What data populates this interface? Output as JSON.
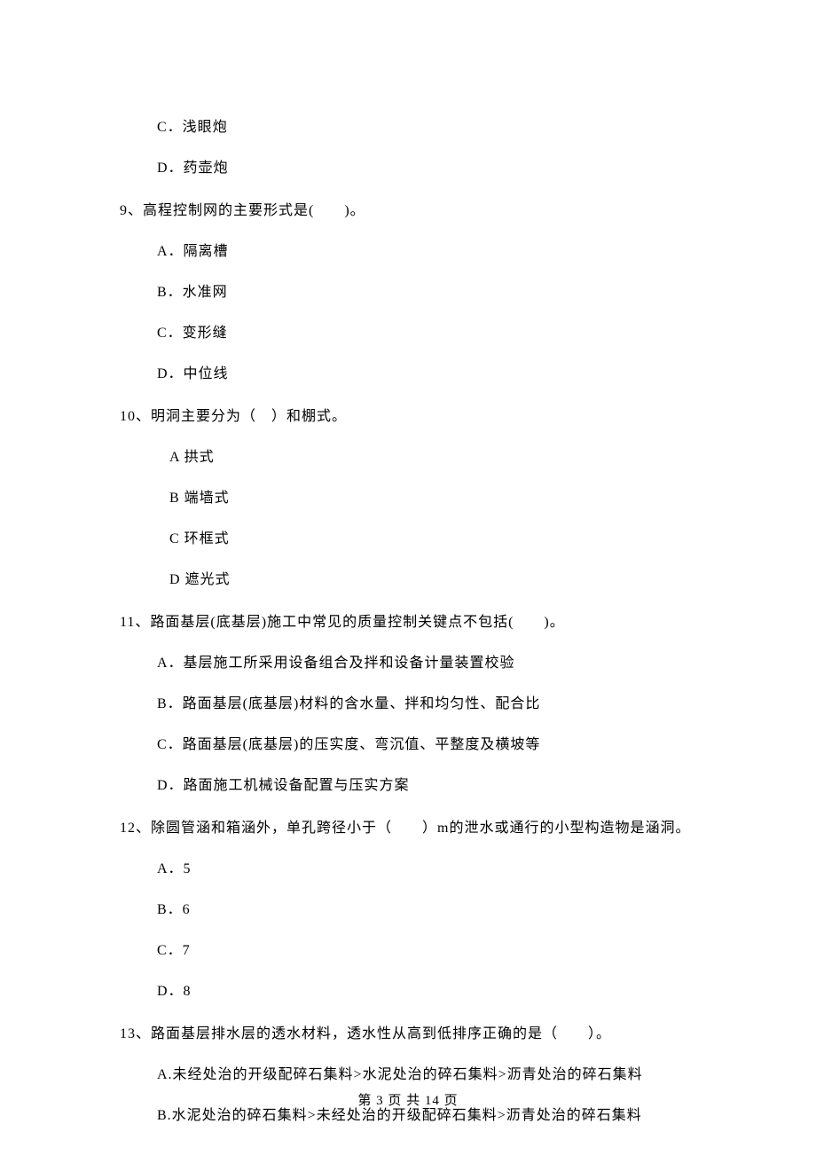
{
  "prev_options": {
    "c": "C．浅眼炮",
    "d": "D．药壶炮"
  },
  "q9": {
    "text": "9、高程控制网的主要形式是(　　)。",
    "a": "A．隔离槽",
    "b": "B．水准网",
    "c": "C．变形缝",
    "d": "D．中位线"
  },
  "q10": {
    "text": "10、明洞主要分为（　）和棚式。",
    "a": "A 拱式",
    "b": "B 端墙式",
    "c": "C 环框式",
    "d": "D 遮光式"
  },
  "q11": {
    "text": "11、路面基层(底基层)施工中常见的质量控制关键点不包括(　　)。",
    "a": "A．基层施工所采用设备组合及拌和设备计量装置校验",
    "b": "B．路面基层(底基层)材料的含水量、拌和均匀性、配合比",
    "c": "C．路面基层(底基层)的压实度、弯沉值、平整度及横坡等",
    "d": "D．路面施工机械设备配置与压实方案"
  },
  "q12": {
    "text": "12、除圆管涵和箱涵外，单孔跨径小于（　　）m的泄水或通行的小型构造物是涵洞。",
    "a": "A．5",
    "b": "B．6",
    "c": "C．7",
    "d": "D．8"
  },
  "q13": {
    "text": "13、路面基层排水层的透水材料，透水性从高到低排序正确的是（　　）。",
    "a": "A.未经处治的开级配碎石集料>水泥处治的碎石集料>沥青处治的碎石集料",
    "b": "B.水泥处治的碎石集料>未经处治的开级配碎石集料>沥青处治的碎石集料"
  },
  "footer": "第 3 页 共 14 页"
}
